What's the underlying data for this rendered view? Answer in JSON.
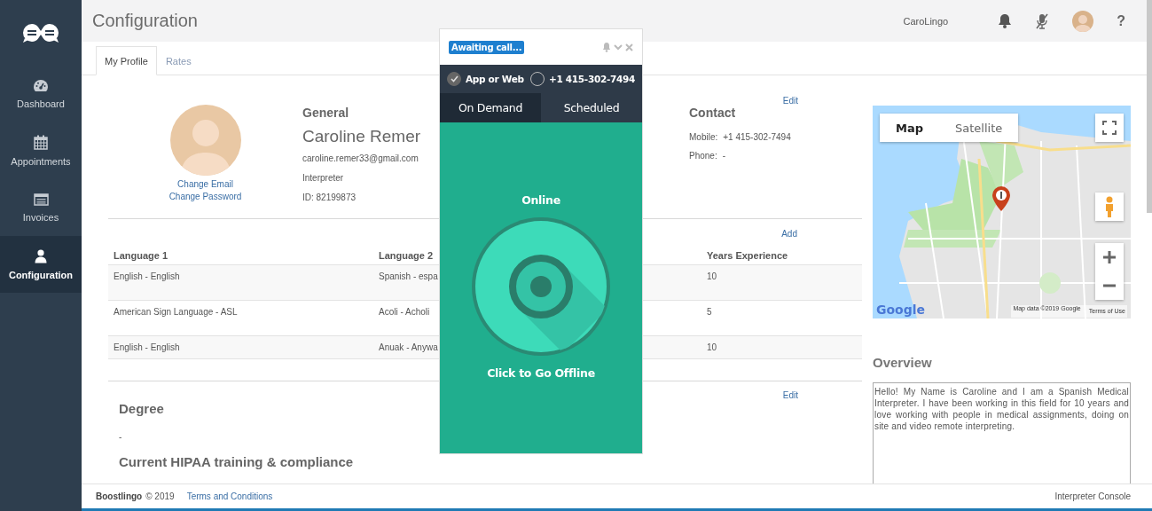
{
  "sidebar": {
    "items": [
      {
        "label": "Dashboard",
        "kind": "dashboard",
        "selected": false
      },
      {
        "label": "Appointments",
        "kind": "calendar",
        "selected": false
      },
      {
        "label": "Invoices",
        "kind": "invoice",
        "selected": false
      },
      {
        "label": "Configuration",
        "kind": "user",
        "selected": true
      }
    ]
  },
  "header": {
    "title": "Configuration",
    "username": "CaroLingo",
    "help": "?"
  },
  "tabs": [
    {
      "label": "My Profile",
      "selected": true
    },
    {
      "label": "Rates",
      "selected": false
    }
  ],
  "profile": {
    "links": [
      "Change Email",
      "Change Password"
    ],
    "general": {
      "heading": "General",
      "name": "Caroline Remer",
      "lines": [
        "caroline.remer33@gmail.com",
        "Interpreter",
        "ID: 82199873"
      ]
    },
    "contact": {
      "edit": "Edit",
      "heading": "Contact",
      "fields": [
        {
          "label": "Mobile:",
          "value": "+1 415-302-7494"
        },
        {
          "label": "Phone:",
          "value": "-"
        }
      ]
    }
  },
  "languages": {
    "add": "Add",
    "columns": [
      "Language 1",
      "Language 2",
      "Years Experience"
    ],
    "rows": [
      [
        "English - English",
        "Spanish - espa",
        "10"
      ],
      [
        "American Sign Language - ASL",
        "Acoli - Acholi",
        "5"
      ],
      [
        "English - English",
        "Anuak - Anywa",
        "10"
      ]
    ]
  },
  "degree": {
    "edit": "Edit",
    "heading": "Degree",
    "value": "-",
    "hipaa_heading": "Current HIPAA training & compliance"
  },
  "map": {
    "map_types": [
      {
        "label": "Map",
        "selected": true
      },
      {
        "label": "Satellite",
        "selected": false
      }
    ],
    "logo": "Google",
    "attribution": "Map data ©2019 Google",
    "terms": "Terms of Use"
  },
  "overview": {
    "heading": "Overview",
    "text": "Hello! My Name is Caroline and I am a Spanish Medical Interpreter. I have been working in this field for 10 years and love working with people in medical assignments, doing on site and video remote interpreting."
  },
  "footer": {
    "brand": "Boostlingo",
    "copyright": "© 2019",
    "link": "Terms and Conditions",
    "right": "Interpreter Console"
  },
  "widget": {
    "status": "Awaiting call...",
    "channels": [
      {
        "label": "App or Web",
        "selected": true
      },
      {
        "label": "+1 415-302-7494",
        "selected": false
      }
    ],
    "modes": [
      {
        "label": "On Demand",
        "selected": true
      },
      {
        "label": "Scheduled",
        "selected": false
      }
    ],
    "state": "Online",
    "action": "Click to Go Offline"
  }
}
